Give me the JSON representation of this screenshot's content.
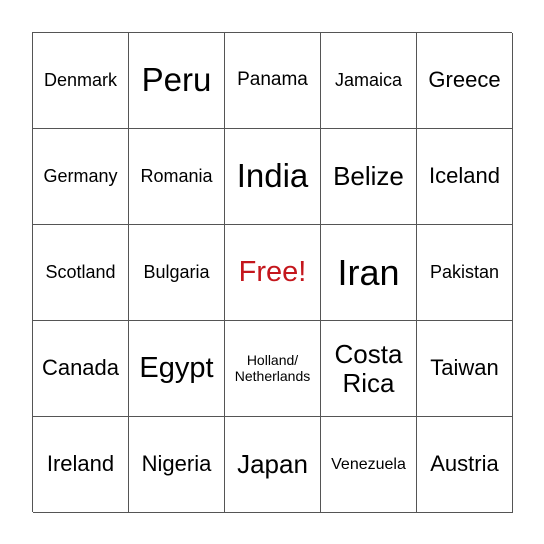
{
  "board": {
    "free_color": "#c4161c",
    "cells": [
      {
        "text": "Denmark",
        "size": "s18"
      },
      {
        "text": "Peru",
        "size": "s33"
      },
      {
        "text": "Panama",
        "size": "s19"
      },
      {
        "text": "Jamaica",
        "size": "s18"
      },
      {
        "text": "Greece",
        "size": "s22"
      },
      {
        "text": "Germany",
        "size": "s18"
      },
      {
        "text": "Romania",
        "size": "s18"
      },
      {
        "text": "India",
        "size": "s33"
      },
      {
        "text": "Belize",
        "size": "s26"
      },
      {
        "text": "Iceland",
        "size": "s22"
      },
      {
        "text": "Scotland",
        "size": "s18"
      },
      {
        "text": "Bulgaria",
        "size": "s18"
      },
      {
        "text": "Free!",
        "size": "s29",
        "free": true
      },
      {
        "text": "Iran",
        "size": "s36"
      },
      {
        "text": "Pakistan",
        "size": "s18"
      },
      {
        "text": "Canada",
        "size": "s22"
      },
      {
        "text": "Egypt",
        "size": "s29"
      },
      {
        "text": "Holland/\nNetherlands",
        "size": "s14"
      },
      {
        "text": "Costa\nRica",
        "size": "s26"
      },
      {
        "text": "Taiwan",
        "size": "s22"
      },
      {
        "text": "Ireland",
        "size": "s22"
      },
      {
        "text": "Nigeria",
        "size": "s22"
      },
      {
        "text": "Japan",
        "size": "s26"
      },
      {
        "text": "Venezuela",
        "size": "s16"
      },
      {
        "text": "Austria",
        "size": "s22"
      }
    ]
  }
}
